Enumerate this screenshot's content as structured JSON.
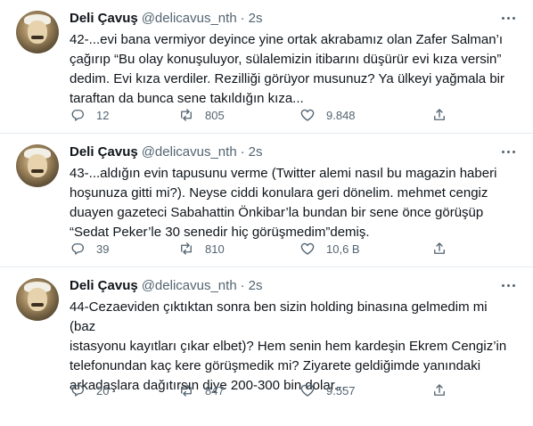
{
  "tweets": [
    {
      "name": "Deli Çavuş",
      "handle": "@delicavus_nth",
      "separator": "·",
      "time": "2s",
      "text": "42-...evi bana vermiyor deyince yine ortak akrabamız olan Zafer Salman’ı\nçağırıp “Bu olay konuşuluyor, sülalemizin itibarını düşürür evi kıza versin”\ndedim. Evi kıza verdiler. Rezilliği görüyor musunuz? Ya ülkeyi yağmala bir\ntaraftan da bunca sene takıldığın kıza...",
      "replies": "12",
      "retweets": "805",
      "likes": "9.848"
    },
    {
      "name": "Deli Çavuş",
      "handle": "@delicavus_nth",
      "separator": "·",
      "time": "2s",
      "text": "43-...aldığın evin tapusunu verme (Twitter alemi nasıl bu magazin haberi\nhoşunuza gitti mi?). Neyse ciddi konulara geri dönelim. mehmet cengiz\nduayen gazeteci Sabahattin Önkibar’la bundan bir sene önce görüşüp\n“Sedat Peker’le 30 senedir hiç görüşmedim”demiş.",
      "replies": "39",
      "retweets": "810",
      "likes": "10,6 B"
    },
    {
      "name": "Deli Çavuş",
      "handle": "@delicavus_nth",
      "separator": "·",
      "time": "2s",
      "text": "44-Cezaeviden çıktıktan sonra ben sizin holding binasına gelmedim mi (baz\nistasyonu kayıtları çıkar elbet)? Hem senin hem kardeşin Ekrem Cengiz’in\ntelefonundan kaç kere görüşmedik mi? Ziyarete geldiğimde yanındaki\narkadaşlara dağıtırsın diye 200-300 bin dolar...",
      "replies": "20",
      "retweets": "847",
      "likes": "9.557"
    }
  ],
  "icons": {
    "reply": "reply-icon",
    "retweet": "retweet-icon",
    "like": "like-icon",
    "share": "share-icon",
    "more": "more-icon"
  }
}
